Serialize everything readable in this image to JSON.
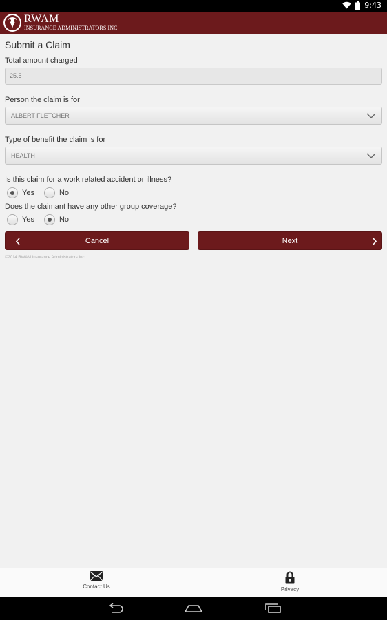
{
  "status_bar": {
    "time": "9:43"
  },
  "header": {
    "brand_name": "RWAM",
    "brand_subtitle": "INSURANCE ADMINISTRATORS INC."
  },
  "form": {
    "title": "Submit a Claim",
    "amount_label": "Total amount charged",
    "amount_value": "25.5",
    "person_label": "Person the claim is for",
    "person_value": "ALBERT FLETCHER",
    "benefit_label": "Type of benefit the claim is for",
    "benefit_value": "HEALTH",
    "work_related_question": "Is this claim for a work related accident or illness?",
    "work_related_yes": "Yes",
    "work_related_no": "No",
    "work_related_selected": "Yes",
    "coverage_question": "Does the claimant have any other group coverage?",
    "coverage_yes": "Yes",
    "coverage_no": "No",
    "coverage_selected": "No"
  },
  "buttons": {
    "cancel": "Cancel",
    "next": "Next"
  },
  "copyright": "©2014 RWAM Insurance Administrators Inc.",
  "bottom_nav": {
    "contact": "Contact Us",
    "privacy": "Privacy"
  },
  "colors": {
    "brand": "#6c1a1c",
    "background": "#f1f1f1"
  }
}
